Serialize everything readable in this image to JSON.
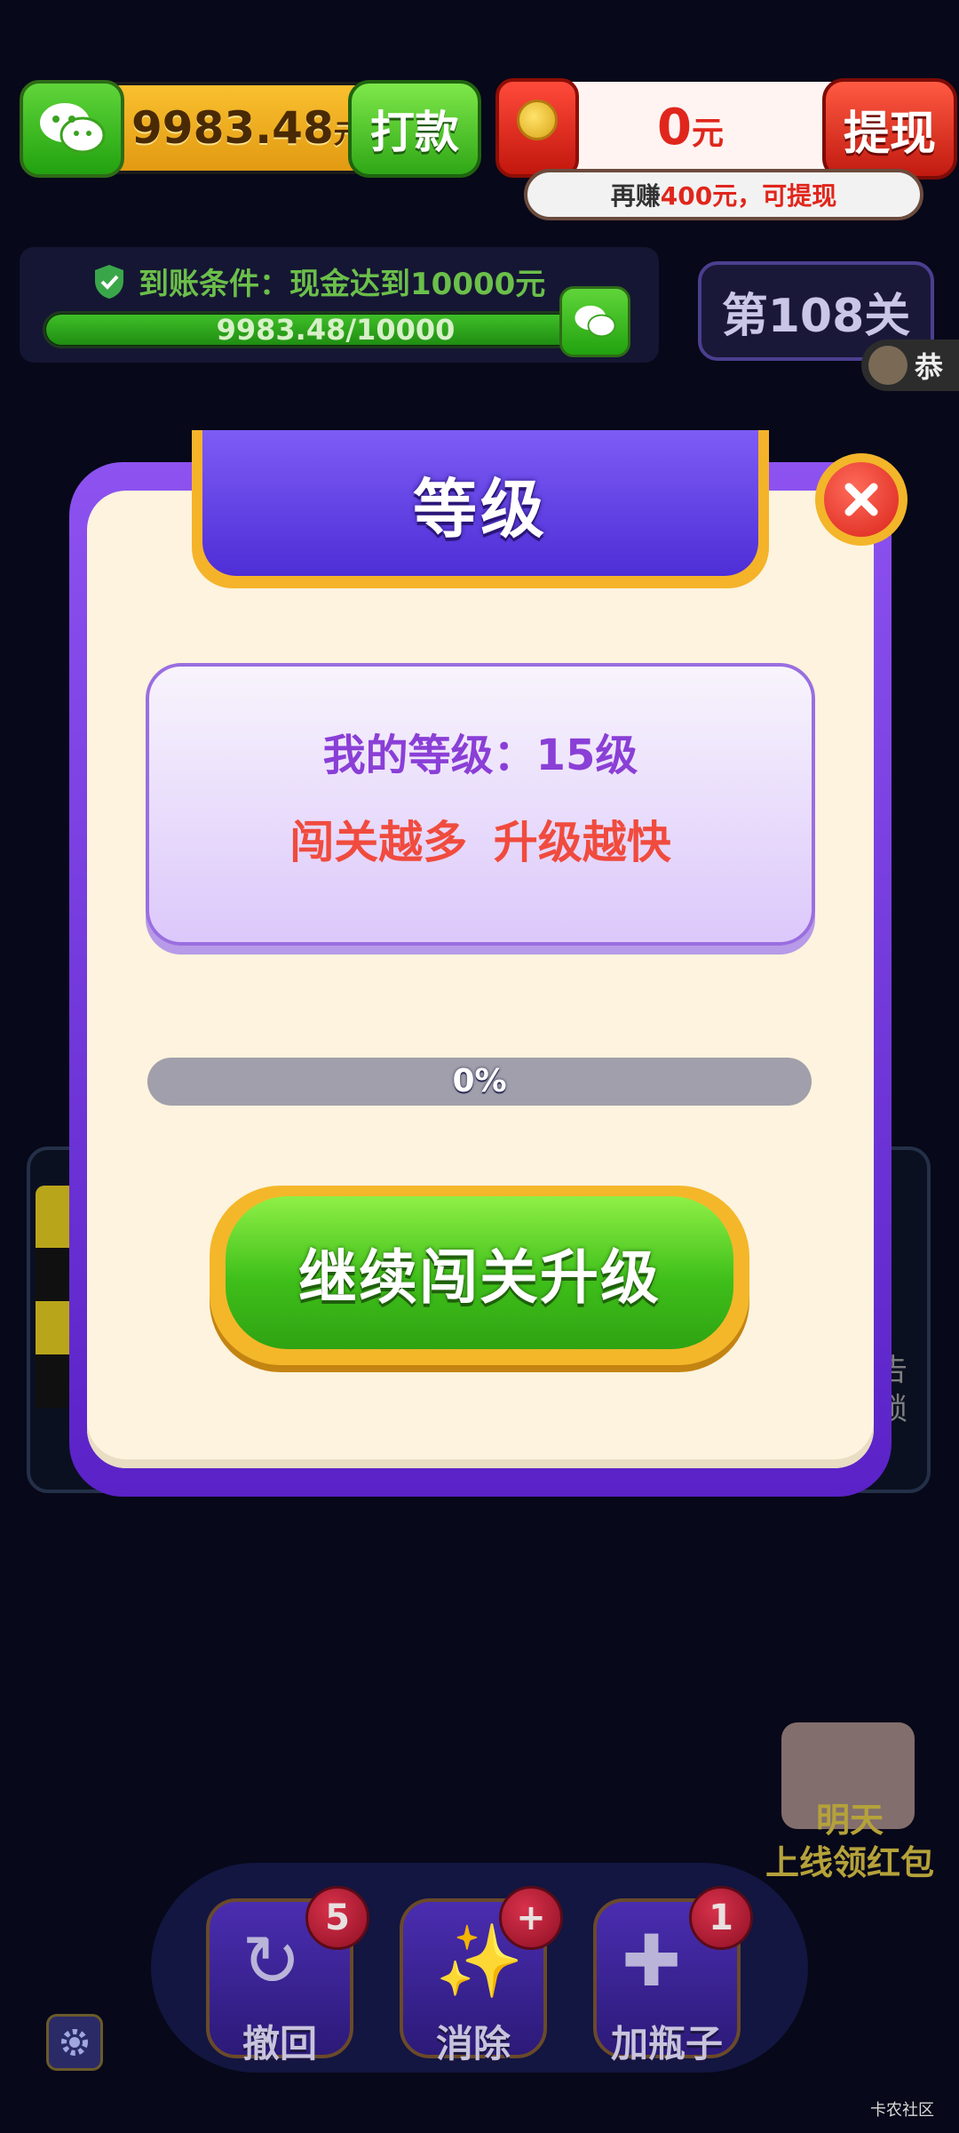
{
  "hud": {
    "cash_amount": "9983.48",
    "cash_unit": "元",
    "pay_label": "打款",
    "redpacket_amount": "0",
    "redpacket_unit": "元",
    "withdraw_label": "提现",
    "earn_tip_prefix": "再赚",
    "earn_tip_amount": "400元",
    "earn_tip_suffix": "，可提现"
  },
  "condition": {
    "text": "到账条件：现金达到10000元",
    "progress_text": "9983.48/10000",
    "progress_fraction": 0.9983
  },
  "level_chip": "第108关",
  "notice_text": "恭",
  "side_text": [
    "告",
    "锁"
  ],
  "modal": {
    "title": "等级",
    "my_level": "我的等级：15级",
    "slogan": "闯关越多  升级越快",
    "progress_text": "0%",
    "progress_percent": 0,
    "continue_label": "继续闯关升级"
  },
  "tomorrow": {
    "line1": "明天",
    "line2": "上线领红包"
  },
  "tools": [
    {
      "label": "撤回",
      "badge": "5",
      "icon": "undo-icon"
    },
    {
      "label": "消除",
      "badge": "+",
      "icon": "magic-wand-icon"
    },
    {
      "label": "加瓶子",
      "badge": "1",
      "icon": "add-bottle-icon"
    }
  ],
  "watermark": "卡农社区",
  "colors": {
    "modal_border": "#7a3fe8",
    "modal_bg": "#fdf3de",
    "ribbon": "#5a37e0",
    "continue_button": "#46c41f",
    "accent_gold": "#f4b72a",
    "level_text": "#8a3fd6",
    "slogan_text": "#f04b3e"
  }
}
